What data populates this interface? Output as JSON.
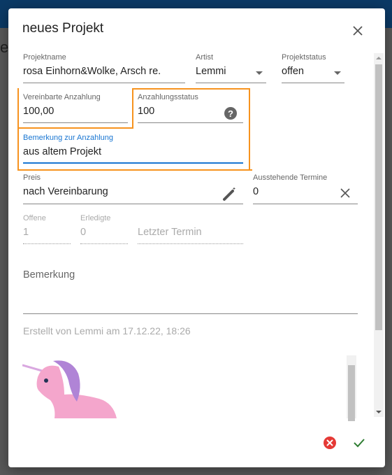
{
  "dialog": {
    "title": "neues Projekt"
  },
  "fields": {
    "projektname": {
      "label": "Projektname",
      "value": "rosa Einhorn&Wolke, Arsch re."
    },
    "artist": {
      "label": "Artist",
      "value": "Lemmi"
    },
    "projektstatus": {
      "label": "Projektstatus",
      "value": "offen"
    },
    "anzahlung": {
      "label": "Vereinbarte Anzahlung",
      "value": "100,00"
    },
    "anzahlungsstatus": {
      "label": "Anzahlungsstatus",
      "value": "100"
    },
    "bemerkung_anzahlung": {
      "label": "Bemerkung zur Anzahlung",
      "value": "aus altem Projekt"
    },
    "preis": {
      "label": "Preis",
      "value": "nach Vereinbarung"
    },
    "ausstehende": {
      "label": "Ausstehende Termine",
      "value": "0"
    },
    "offene": {
      "label": "Offene",
      "value": "1"
    },
    "erledigte": {
      "label": "Erledigte",
      "value": "0"
    },
    "letzter": {
      "placeholder": "Letzter Termin"
    },
    "bemerkung": {
      "placeholder": "Bemerkung"
    }
  },
  "created": "Erstellt von Lemmi am 17.12.22, 18:26",
  "colors": {
    "highlight": "#f7931e",
    "focus": "#1976d2",
    "cancel": "#e53935",
    "confirm": "#2e7d32"
  }
}
